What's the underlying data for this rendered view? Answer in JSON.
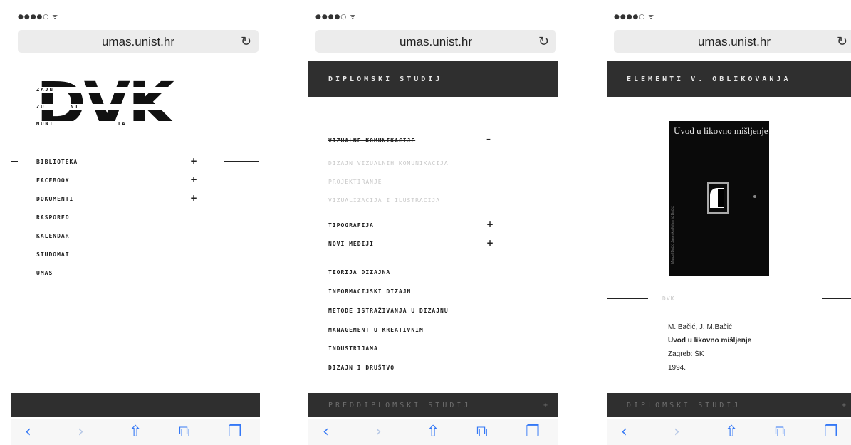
{
  "browser": {
    "status": "●●●●○ ᯤ",
    "url": "umas.unist.hr",
    "reload_icon": "reload-icon",
    "toolbar": {
      "back": "‹",
      "forward": "›",
      "share": "⇧",
      "bookmarks": "⧉",
      "tabs": "❐"
    }
  },
  "screen1": {
    "logo": "DVK",
    "logo_fragments": [
      "ZAJN",
      "ZU",
      "NI",
      "MUNI",
      "IA"
    ],
    "menu": [
      {
        "label": "BIBLIOTEKA",
        "plus": "+"
      },
      {
        "label": "FACEBOOK",
        "plus": "+"
      },
      {
        "label": "DOKUMENTI",
        "plus": "+"
      },
      {
        "label": "RASPORED",
        "plus": ""
      },
      {
        "label": "KALENDAR",
        "plus": ""
      },
      {
        "label": "STUDOMAT",
        "plus": ""
      },
      {
        "label": "UMAS",
        "plus": ""
      }
    ]
  },
  "screen2": {
    "header": "DIPLOMSKI STUDIJ",
    "section_open": {
      "label": "VIZUALNE KOMUNIKACIJE",
      "minus": "–"
    },
    "sub_items": [
      "DIZAJN VIZUALNIH KOMUNIKACIJA",
      "PROJEKTIRANJE",
      "VIZUALIZACIJA I ILUSTRACIJA"
    ],
    "sections": [
      {
        "label": "TIPOGRAFIJA",
        "plus": "+"
      },
      {
        "label": "NOVI MEDIJI",
        "plus": "+"
      }
    ],
    "courses": [
      "TEORIJA DIZAJNA",
      "INFORMACIJSKI DIZAJN",
      "METODE ISTRAŽIVANJA U DIZAJNU",
      "MANAGEMENT U KREATIVNIM",
      "INDUSTRIJAMA",
      "DIZAJN I DRUŠTVO"
    ],
    "footer": "PREDDIPLOMSKI STUDIJ",
    "footer_plus": "+"
  },
  "screen3": {
    "header": "ELEMENTI V. OBLIKOVANJA",
    "cover_title": "Uvod u likovno mišljenje",
    "cover_spine": "Marcel Bačić  Jasenka Mihanić Bačić",
    "tag": "DVK",
    "authors": "M. Bačić, J. M.Bačić",
    "title": "Uvod u likovno mišljenje",
    "publisher": "Zagreb: ŠK",
    "year": "1994.",
    "footer": "DIPLOMSKI STUDIJ",
    "footer_plus": "+"
  }
}
